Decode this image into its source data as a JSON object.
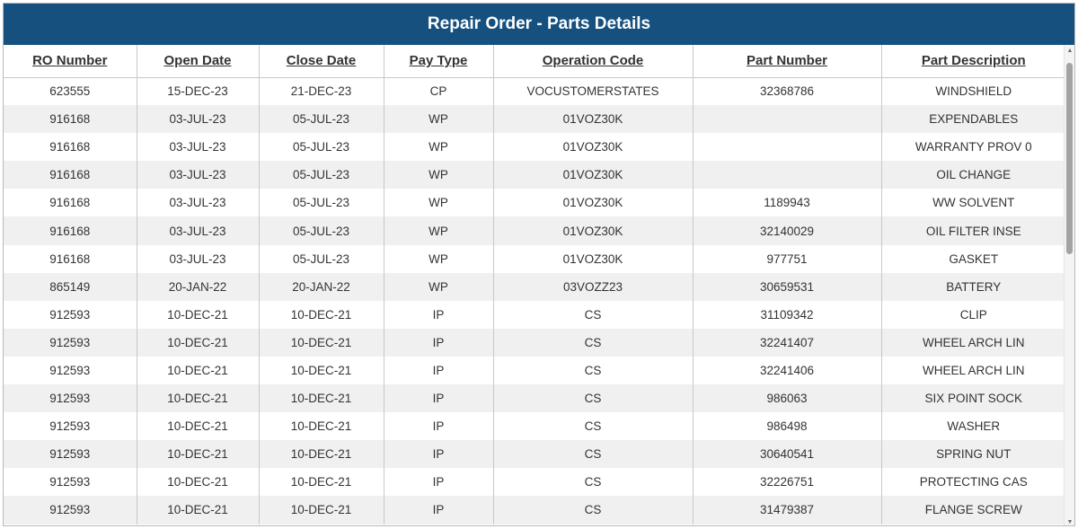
{
  "title": "Repair Order - Parts Details",
  "columns": [
    "RO Number",
    "Open Date",
    "Close Date",
    "Pay Type",
    "Operation Code",
    "Part Number",
    "Part Description"
  ],
  "rows": [
    [
      "623555",
      "15-DEC-23",
      "21-DEC-23",
      "CP",
      "VOCUSTOMERSTATES",
      "32368786",
      "WINDSHIELD"
    ],
    [
      "916168",
      "03-JUL-23",
      "05-JUL-23",
      "WP",
      "01VOZ30K",
      "",
      "EXPENDABLES"
    ],
    [
      "916168",
      "03-JUL-23",
      "05-JUL-23",
      "WP",
      "01VOZ30K",
      "",
      "WARRANTY PROV 0"
    ],
    [
      "916168",
      "03-JUL-23",
      "05-JUL-23",
      "WP",
      "01VOZ30K",
      "",
      "OIL CHANGE"
    ],
    [
      "916168",
      "03-JUL-23",
      "05-JUL-23",
      "WP",
      "01VOZ30K",
      "1189943",
      "WW SOLVENT"
    ],
    [
      "916168",
      "03-JUL-23",
      "05-JUL-23",
      "WP",
      "01VOZ30K",
      "32140029",
      "OIL FILTER INSE"
    ],
    [
      "916168",
      "03-JUL-23",
      "05-JUL-23",
      "WP",
      "01VOZ30K",
      "977751",
      "GASKET"
    ],
    [
      "865149",
      "20-JAN-22",
      "20-JAN-22",
      "WP",
      "03VOZZ23",
      "30659531",
      "BATTERY"
    ],
    [
      "912593",
      "10-DEC-21",
      "10-DEC-21",
      "IP",
      "CS",
      "31109342",
      "CLIP"
    ],
    [
      "912593",
      "10-DEC-21",
      "10-DEC-21",
      "IP",
      "CS",
      "32241407",
      "WHEEL ARCH LIN"
    ],
    [
      "912593",
      "10-DEC-21",
      "10-DEC-21",
      "IP",
      "CS",
      "32241406",
      "WHEEL ARCH LIN"
    ],
    [
      "912593",
      "10-DEC-21",
      "10-DEC-21",
      "IP",
      "CS",
      "986063",
      "SIX POINT SOCK"
    ],
    [
      "912593",
      "10-DEC-21",
      "10-DEC-21",
      "IP",
      "CS",
      "986498",
      "WASHER"
    ],
    [
      "912593",
      "10-DEC-21",
      "10-DEC-21",
      "IP",
      "CS",
      "30640541",
      "SPRING NUT"
    ],
    [
      "912593",
      "10-DEC-21",
      "10-DEC-21",
      "IP",
      "CS",
      "32226751",
      "PROTECTING CAS"
    ],
    [
      "912593",
      "10-DEC-21",
      "10-DEC-21",
      "IP",
      "CS",
      "31479387",
      "FLANGE SCREW"
    ]
  ],
  "colors": {
    "header_bg": "#16507f",
    "header_text": "#ffffff",
    "row_alt_bg": "#f0f0f0"
  },
  "icons": {
    "scroll_up": "▲",
    "scroll_down": "▼"
  }
}
